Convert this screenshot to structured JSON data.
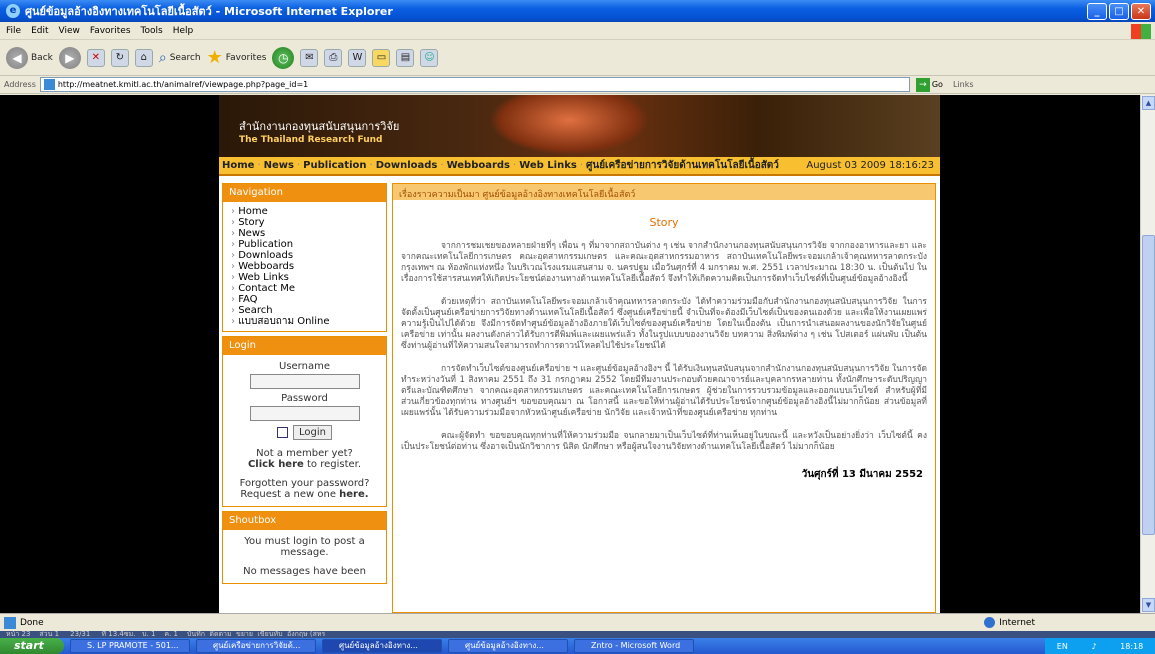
{
  "window": {
    "title": "ศูนย์ข้อมูลอ้างอิงทางเทคโนโลยีเนื้อสัตว์ - Microsoft Internet Explorer",
    "minimize": "_",
    "maximize": "□",
    "close": "✕"
  },
  "menu": [
    "File",
    "Edit",
    "View",
    "Favorites",
    "Tools",
    "Help"
  ],
  "toolbar": {
    "back": "Back",
    "search": "Search",
    "favorites": "Favorites"
  },
  "address": {
    "label": "Address",
    "url": "http://meatnet.kmitl.ac.th/animalref/viewpage.php?page_id=1",
    "go": "Go",
    "links": "Links"
  },
  "banner": {
    "line1": "สำนักงานกองทุนสนับสนุนการวิจัย",
    "line2": "The Thailand Research Fund"
  },
  "navbar": {
    "items": [
      "Home",
      "News",
      "Publication",
      "Downloads",
      "Webboards",
      "Web Links",
      "ศูนย์เครือข่ายการวิจัยด้านเทคโนโลยีเนื้อสัตว์"
    ],
    "date": "August 03 2009 18:16:23"
  },
  "navigation": {
    "title": "Navigation",
    "items": [
      "Home",
      "Story",
      "News",
      "Publication",
      "Downloads",
      "Webboards",
      "Web Links",
      "Contact Me",
      "FAQ",
      "Search",
      "แบบสอบถาม Online"
    ]
  },
  "login": {
    "title": "Login",
    "username": "Username",
    "password": "Password",
    "button": "Login",
    "not_member": "Not a member yet?",
    "click_here": "Click here",
    "to_register": "to register.",
    "forgotten": "Forgotten your password?",
    "request": "Request a new one",
    "here": "here."
  },
  "shoutbox": {
    "title": "Shoutbox",
    "must_login": "You must login to post a message.",
    "no_messages": "No messages have been"
  },
  "main": {
    "header": "เรื่องราวความเป็นมา ศูนย์ข้อมูลอ้างอิงทางเทคโนโลยีเนื้อสัตว์",
    "story_title": "Story",
    "paragraphs": [
      "จากการชมเชยของหลายฝ่ายที่ๆ เพื่อน ๆ ที่มาจากสถาบันต่าง ๆ เช่น จากสำนักงานกองทุนสนับสนุนการวิจัย จากกองอาหารและยา และจากคณะเทคโนโลยีการเกษตร คณะอุตสาหกรรมเกษตร และคณะอุตสาหกรรมอาหาร สถาบันเทคโนโลยีพระจอมเกล้าเจ้าคุณทหารลาดกระบัง กรุงเทพฯ ณ ห้องพักแห่งหนึ่ง ในบริเวณโรงแรมแสนสาม จ. นครปฐม เมื่อวันศุกร์ที่ 4 มกราคม พ.ศ. 2551 เวลาประมาณ 18:30 น. เป็นต้นไป ในเรื่องการใช้สารสนเทศให้เกิดประโยชน์ต่องานทางด้านเทคโนโลยีเนื้อสัตว์ จึงทำให้เกิดความคิดเป็นการจัดทำเว็บไซต์ที่เป็นศูนย์ข้อมูลอ้างอิงนี้",
      "ด้วยเหตุที่ว่า สถาบันเทคโนโลยีพระจอมเกล้าเจ้าคุณทหารลาดกระบัง ได้ทำความร่วมมือกับสำนักงานกองทุนสนับสนุนการวิจัย ในการจัดตั้งเป็นศูนย์เครือข่ายการวิจัยทางด้านเทคโนโลยีเนื้อสัตว์ ซึ่งศูนย์เครือข่ายนี้ จำเป็นที่จะต้องมีเว็บไซต์เป็นของตนเองด้วย และเพื่อให้งานเผยแพร่ความรู้เป็นไปได้ด้วย จึงมีการจัดทำศูนย์ข้อมูลอ้างอิงภายใต้เว็บไซต์ของศูนย์เครือข่าย โดยในเบื้องต้น เป็นการนำเสนอผลงานของนักวิจัยในศูนย์เครือข่าย เท่านั้น ผลงานดังกล่าวได้รับการตีพิมพ์และเผยแพร่แล้ว ทั้งในรูปแบบของงานวิจัย บทความ สิ่งพิมพ์ต่าง ๆ เช่น โปสเตอร์ แผ่นพับ เป็นต้น ซึ่งท่านผู้อ่านที่ให้ความสนใจสามารถทำการดาวน์โหลดไปใช้ประโยชน์ได้",
      "การจัดทำเว็บไซต์ของศูนย์เครือข่าย ฯ และศูนย์ข้อมูลอ้างอิงฯ นี้ ได้รับเงินทุนสนับสนุนจากสำนักงานกองทุนสนับสนุนการวิจัย ในการจัดทำระหว่างวันที่ 1 สิงหาคม 2551 ถึง 31 กรกฎาคม 2552 โดยมีทีมงานประกอบด้วยคณาจารย์และบุคลากรหลายท่าน ทั้งนักศึกษาระดับปริญญาตรีและบัณฑิตศึกษา จากคณะอุตสาหกรรมเกษตร และคณะเทคโนโลยีการเกษตร ผู้ช่วยในการรวบรวมข้อมูลและออกแบบเว็บไซต์ สำหรับผู้ที่มีส่วนเกี่ยวข้องทุกท่าน ทางศูนย์ฯ ขอขอบคุณมา ณ โอกาสนี้ และขอให้ท่านผู้อ่านได้รับประโยชน์จากศูนย์ข้อมูลอ้างอิงนี้ไม่มากก็น้อย ส่วนข้อมูลที่เผยแพร่นั้น ได้รับความร่วมมือจากหัวหน้าศูนย์เครือข่าย นักวิจัย และเจ้าหน้าที่ของศูนย์เครือข่าย ทุกท่าน",
      "คณะผู้จัดทำ ขอขอบคุณทุกท่านที่ให้ความร่วมมือ จนกลายมาเป็นเว็บไซต์ที่ท่านเห็นอยู่ในขณะนี้ และหวังเป็นอย่างยิ่งว่า เว็บไซต์นี้ คงเป็นประโยชน์ต่อท่าน ซึ่งอาจเป็นนักวิชาการ นิสิต นักศึกษา หรือผู้สนใจงานวิจัยทางด้านเทคโนโลยีเนื้อสัตว์ ไม่มากก็น้อย"
    ],
    "signature": "วันศุกร์ที่ 13 มีนาคม 2552"
  },
  "status": {
    "text": "Done",
    "zone": "Internet"
  },
  "wordbar": "หน้า 23    ส่วน 1     23/31     ที่ 13.4ซม.   บ. 1    ค. 1    บันทึก  ติดตาม  ขยาย  เขียนทับ  อังกฤษ (สหร",
  "taskbar": {
    "start": "start",
    "tasks": [
      "S. LP PRAMOTE - 501...",
      "ศูนย์เครือข่ายการวิจัยด้...",
      "ศูนย์ข้อมูลอ้างอิงทาง...",
      "ศูนย์ข้อมูลอ้างอิงทาง...",
      "Zntro - Microsoft Word"
    ],
    "lang": "EN",
    "clock": "18:18"
  }
}
